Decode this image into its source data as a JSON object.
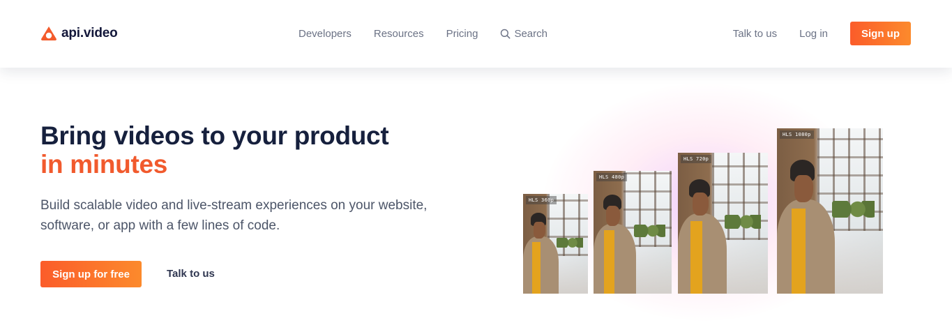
{
  "header": {
    "brand": "api.video",
    "nav": [
      "Developers",
      "Resources",
      "Pricing"
    ],
    "search_label": "Search",
    "talk_label": "Talk to us",
    "login_label": "Log in",
    "signup_label": "Sign up"
  },
  "hero": {
    "title_line1": "Bring videos to your product",
    "title_line2": "in minutes",
    "subtitle": "Build scalable video and live-stream experiences on your website, software, or app with a few lines of code.",
    "cta_primary": "Sign up for free",
    "cta_secondary": "Talk to us"
  },
  "illustration": {
    "frames": [
      {
        "label": "HLS 360p"
      },
      {
        "label": "HLS 480p"
      },
      {
        "label": "HLS 720p"
      },
      {
        "label": "HLS 1080p"
      }
    ]
  },
  "colors": {
    "accent": "#f15a2d",
    "button_gradient_start": "#fb5c2a",
    "button_gradient_end": "#fc8a2c",
    "title": "#16203d",
    "nav_text": "#6b7285"
  },
  "icons": {
    "logo": "api-video-logo-icon",
    "search": "search-icon"
  }
}
